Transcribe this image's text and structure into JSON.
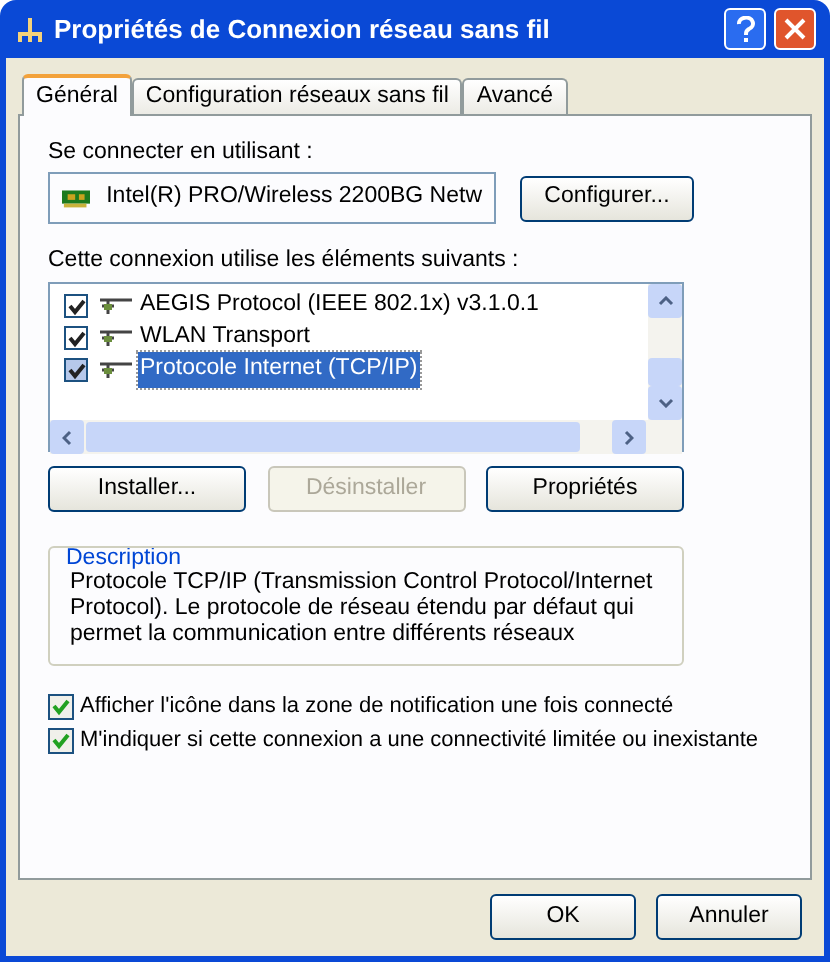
{
  "window": {
    "title": "Propriétés de Connexion réseau sans fil"
  },
  "tabs": [
    {
      "label": "Général",
      "selected": true
    },
    {
      "label": "Configuration réseaux sans fil",
      "selected": false
    },
    {
      "label": "Avancé",
      "selected": false
    }
  ],
  "connect_label": "Se connecter en utilisant :",
  "adapter": "Intel(R) PRO/Wireless 2200BG Netw",
  "configure_button": "Configurer...",
  "components_label": "Cette connexion utilise les éléments suivants :",
  "components": [
    {
      "label": "AEGIS Protocol (IEEE 802.1x) v3.1.0.1",
      "checked": true,
      "selected": false
    },
    {
      "label": "WLAN Transport",
      "checked": true,
      "selected": false
    },
    {
      "label": "Protocole Internet (TCP/IP)",
      "checked": true,
      "selected": true
    }
  ],
  "component_buttons": [
    {
      "label": "Installer...",
      "disabled": false
    },
    {
      "label": "Désinstaller",
      "disabled": true
    },
    {
      "label": "Propriétés",
      "disabled": false
    }
  ],
  "description": {
    "title": "Description",
    "text": "Protocole TCP/IP (Transmission Control Protocol/Internet Protocol). Le protocole de réseau étendu par défaut qui permet la communication entre différents réseaux"
  },
  "options": [
    {
      "label": "Afficher l'icône dans la zone de notification une fois connecté",
      "checked": true
    },
    {
      "label": "M'indiquer si cette connexion a une connectivité limitée ou inexistante",
      "checked": true
    }
  ],
  "buttons": [
    "OK",
    "Annuler"
  ]
}
